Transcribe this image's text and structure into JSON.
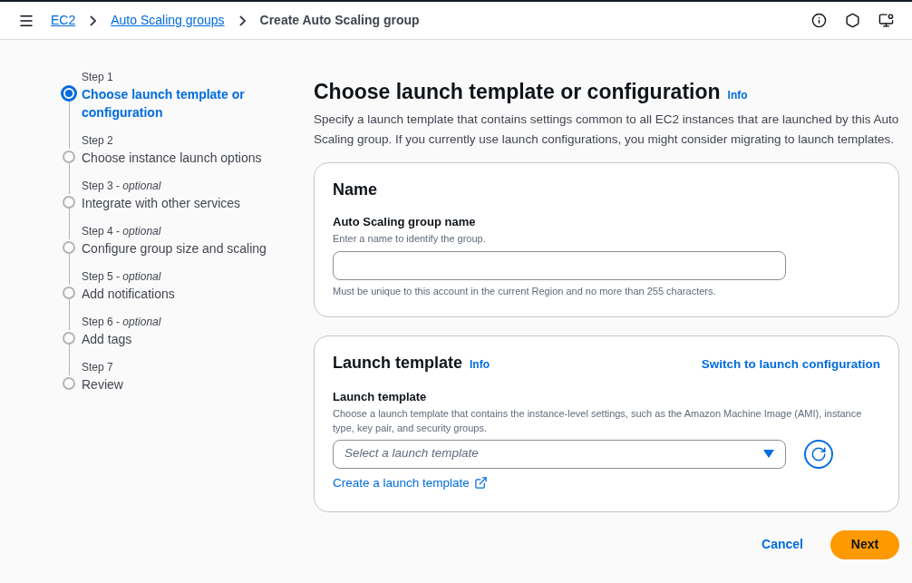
{
  "breadcrumbs": [
    {
      "label": "EC2",
      "link": true
    },
    {
      "label": "Auto Scaling groups",
      "link": true
    },
    {
      "label": "Create Auto Scaling group",
      "link": false
    }
  ],
  "steps": [
    {
      "step": "Step 1",
      "title": "Choose launch template or configuration",
      "selected": true
    },
    {
      "step": "Step 2",
      "title": "Choose instance launch options",
      "selected": false
    },
    {
      "step": "Step 3 - *optional*",
      "title": "Integrate with other services",
      "selected": false
    },
    {
      "step": "Step 4 - *optional*",
      "title": "Configure group size and scaling",
      "selected": false
    },
    {
      "step": "Step 5 - *optional*",
      "title": "Add notifications",
      "selected": false
    },
    {
      "step": "Step 6 - *optional*",
      "title": "Add tags",
      "selected": false
    },
    {
      "step": "Step 7",
      "title": "Review",
      "selected": false
    }
  ],
  "page": {
    "title": "Choose launch template or configuration",
    "info": "Info",
    "description": "Specify a launch template that contains settings common to all EC2 instances that are launched by this Auto Scaling group. If you currently use launch configurations, you might consider migrating to launch templates."
  },
  "name_panel": {
    "title": "Name",
    "field_label": "Auto Scaling group name",
    "field_description": "Enter a name to identify the group.",
    "constraint": "Must be unique to this account in the current Region and no more than 255 characters."
  },
  "launch_panel": {
    "title": "Launch template",
    "info": "Info",
    "switch_link": "Switch to launch configuration",
    "field_label": "Launch template",
    "field_description": "Choose a launch template that contains the instance-level settings, such as the Amazon Machine Image (AMI), instance type, key pair, and security groups.",
    "placeholder": "Select a launch template",
    "create_link": "Create a launch template"
  },
  "buttons": {
    "cancel": "Cancel",
    "next": "Next"
  }
}
